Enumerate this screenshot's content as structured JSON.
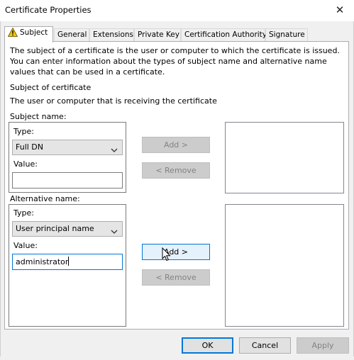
{
  "window": {
    "title": "Certificate Properties",
    "close_glyph": "✕"
  },
  "tabs": [
    {
      "label": "Subject",
      "active": true,
      "icon": "warning-icon"
    },
    {
      "label": "General"
    },
    {
      "label": "Extensions"
    },
    {
      "label": "Private Key"
    },
    {
      "label": "Certification Authority"
    },
    {
      "label": "Signature"
    }
  ],
  "subject_tab": {
    "description": "The subject of a certificate is the user or computer to which the certificate is issued. You can enter information about the types of subject name and alternative name values that can be used in a certificate.",
    "subject_heading": "Subject of certificate",
    "subject_subtext": "The user or computer that is receiving the certificate",
    "subject_name": {
      "group_label": "Subject name:",
      "type_label": "Type:",
      "type_value": "Full DN",
      "value_label": "Value:",
      "value_text": "",
      "add_label": "Add >",
      "remove_label": "< Remove"
    },
    "alternative_name": {
      "group_label": "Alternative name:",
      "type_label": "Type:",
      "type_value": "User principal name",
      "value_label": "Value:",
      "value_text": "administrator",
      "add_label": "Add >",
      "remove_label": "< Remove"
    }
  },
  "footer": {
    "ok": "OK",
    "cancel": "Cancel",
    "apply": "Apply"
  },
  "colors": {
    "accent": "#0078d7",
    "hover_bg": "#e5f1fb",
    "disabled_bg": "#cccccc",
    "warning": "#f2c40e"
  }
}
